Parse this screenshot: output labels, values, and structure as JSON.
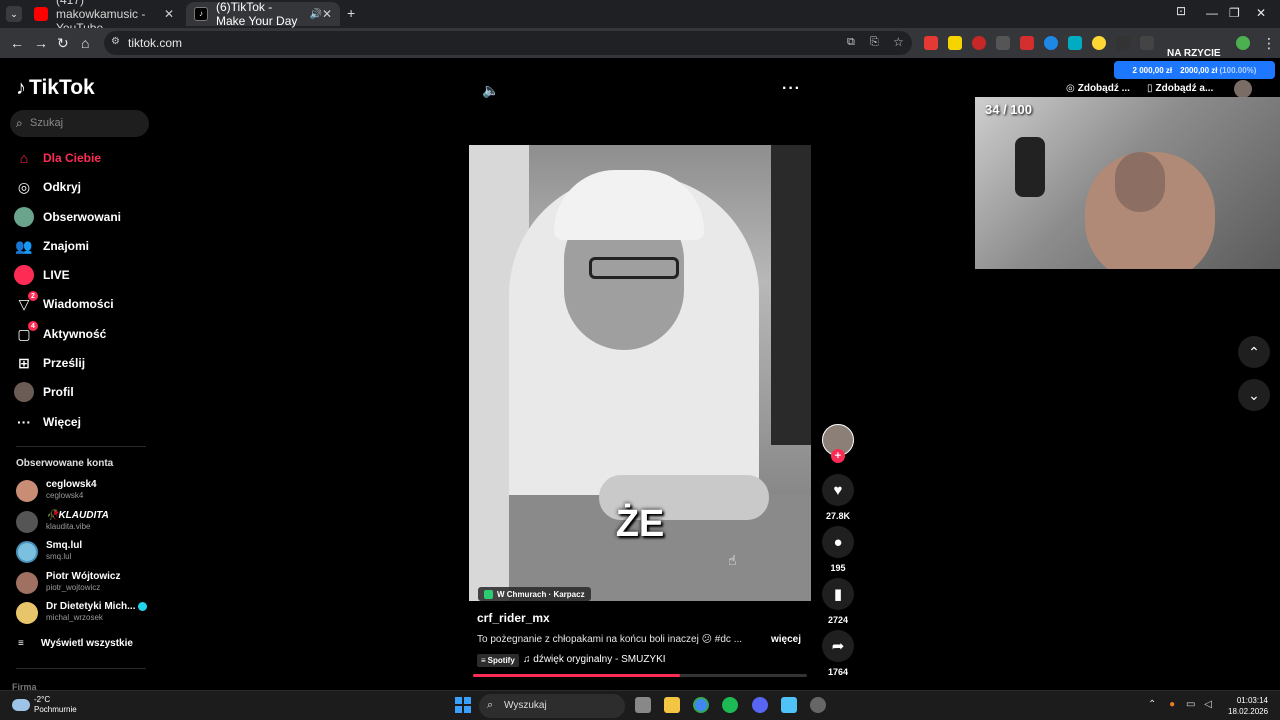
{
  "browser": {
    "tabs": [
      {
        "title": "(417) makowkamusic - YouTube",
        "favicon_color": "#ff0000"
      },
      {
        "title": "(6)TikTok - Make Your Day",
        "favicon_color": "#ffffff"
      }
    ],
    "url": "tiktok.com"
  },
  "tiktok": {
    "logo": "TikTok",
    "search_placeholder": "Szukaj",
    "nav": [
      {
        "label": "Dla Ciebie",
        "icon": "home-icon",
        "active": true
      },
      {
        "label": "Odkryj",
        "icon": "compass-icon"
      },
      {
        "label": "Obserwowani",
        "icon": "following-icon"
      },
      {
        "label": "Znajomi",
        "icon": "friends-icon"
      },
      {
        "label": "LIVE",
        "icon": "live-icon"
      },
      {
        "label": "Wiadomości",
        "icon": "messages-icon",
        "badge": "2"
      },
      {
        "label": "Aktywność",
        "icon": "activity-icon",
        "badge": "4"
      },
      {
        "label": "Prześlij",
        "icon": "upload-icon"
      },
      {
        "label": "Profil",
        "icon": "profile-icon"
      },
      {
        "label": "Więcej",
        "icon": "more-icon"
      }
    ],
    "followed_title": "Obserwowane konta",
    "followed": [
      {
        "name": "ceglowsk4",
        "user": "ceglowsk4"
      },
      {
        "name": "🥀KLAUDITA",
        "user": "klaudita.vibe"
      },
      {
        "name": "Smq.lul",
        "user": "smq.lul"
      },
      {
        "name": "Piotr Wójtowicz",
        "user": "piotr_wojtowicz"
      },
      {
        "name": "Dr Dietetyki Mich...",
        "user": "michal_wrzosek"
      }
    ],
    "view_all": "Wyświetl wszystkie",
    "footer": "Firma"
  },
  "video": {
    "subtitle": "ŻE",
    "location": "W Chmurach · Karpacz",
    "author": "crf_rider_mx",
    "description": "To pożegnanie z chłopakami na końcu boli inaczej 😕 #dc ...",
    "more_label": "więcej",
    "spotify_label": "Spotify",
    "music": "♫  dźwięk oryginalny - SMUZYKI",
    "progress": 0.62,
    "likes": "27.8K",
    "comments": "195",
    "saves": "2724",
    "shares": "1764"
  },
  "overlay": {
    "na_rzycie": "NA RZYCIE",
    "money_left": "2 000,00 zł",
    "money_right": "2000,00 zł",
    "money_pct": "(100.00%)",
    "get_coins_1": "Zdobądź ...",
    "get_coins_2": "Zdobądź a...",
    "cam_counter": "34 / 100"
  },
  "taskbar": {
    "temperature": "-2°C",
    "weather": "Pochmurnie",
    "search": "Wyszukaj",
    "time": "01:03:14",
    "date": "18.02.2026"
  },
  "colors": {
    "accent": "#fe2c55",
    "bg": "#000000",
    "blue": "#1e78ff"
  }
}
